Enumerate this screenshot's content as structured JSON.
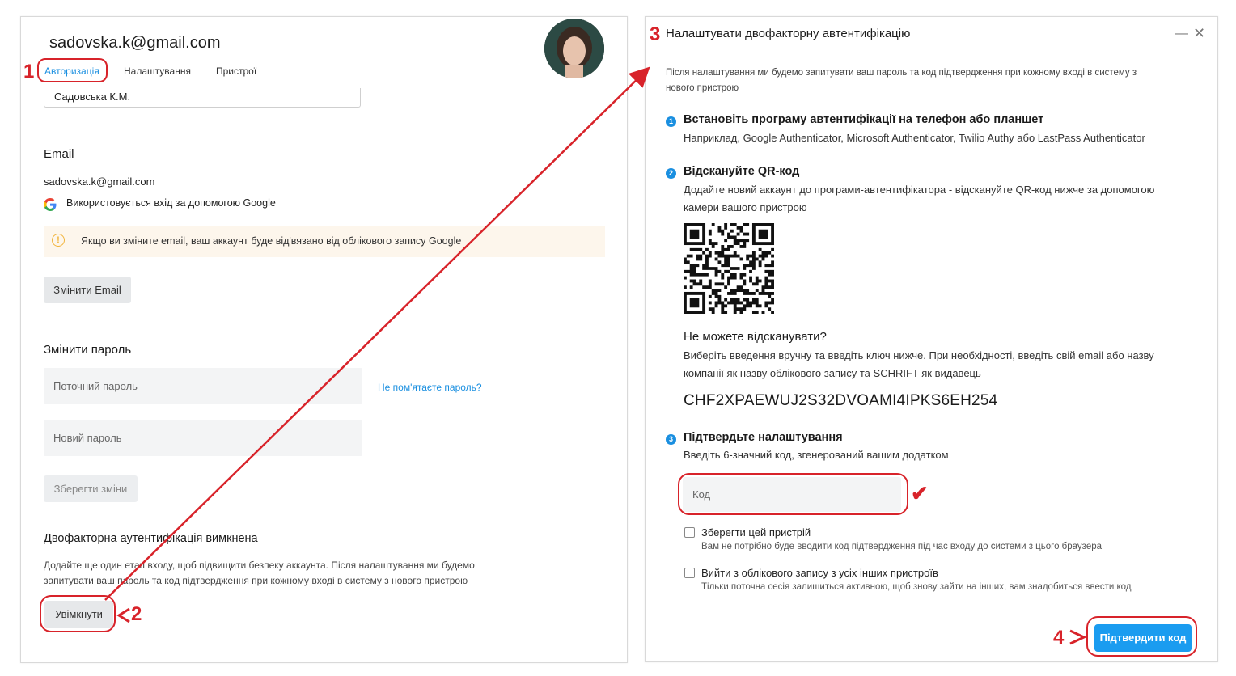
{
  "left": {
    "account_email": "sadovska.k@gmail.com",
    "tabs": [
      "Авторизація",
      "Налаштування",
      "Пристрої"
    ],
    "name_value": "Садовська К.М.",
    "email_section": {
      "title": "Email",
      "email": "sadovska.k@gmail.com",
      "google_note": "Використовується вхід за допомогою Google",
      "warning": "Якщо ви зміните email, ваш аккаунт буде від'вязано від облікового запису Google",
      "change_button": "Змінити Email"
    },
    "password_section": {
      "title": "Змінити пароль",
      "current_placeholder": "Поточний пароль",
      "forgot_link": "Не пом'ятаєте пароль?",
      "new_placeholder": "Новий пароль",
      "save_button": "Зберегти зміни"
    },
    "twofa_section": {
      "title": "Двофакторна аутентифікація вимкнена",
      "desc_line1": "Додайте ще один етап входу, щоб підвищити безпеку аккаунта. Після налаштування ми будемо",
      "desc_line2": "запитувати ваш пароль та код підтвердження при кожному вході в систему з нового пристрою",
      "enable_button": "Увімкнути"
    }
  },
  "right": {
    "title": "Налаштувати двофакторну автентифікацію",
    "intro_line1": "Після налаштування ми будемо запитувати ваш пароль та код підтвердження при кожному вході в систему з",
    "intro_line2": "нового пристрою",
    "steps": [
      {
        "num": "1",
        "title": "Встановіть програму автентифікації на телефон або планшет",
        "text": "Наприклад, Google Authenticator, Microsoft Authenticator, Twilio Authy або LastPass Authenticator"
      },
      {
        "num": "2",
        "title": "Відскануйте QR-код",
        "text1": "Додайте новий аккаунт до програми-автентифікатора - відскануйте QR-код нижче за допомогою",
        "text2": "камери вашого пристрою"
      },
      {
        "num": "3",
        "title": "Підтвердьте налаштування",
        "text": "Введіть 6-значний код, згенерований вашим додатком"
      }
    ],
    "cant_scan_title": "Не можете відсканувати?",
    "cant_scan_line1": "Виберіть введення вручну та введіть ключ нижче. При необхідності, введіть свій email або назву",
    "cant_scan_line2": "компанії як назву облікового запису та SCHRIFT як видавець",
    "secret_key": "CHF2XPAEWUJ2S32DVOAMI4IPKS6EH254",
    "code_placeholder": "Код",
    "remember_device": "Зберегти цей пристрій",
    "remember_device_sub": "Вам не потрібно буде вводити код підтвердження під час входу до системи з цього браузера",
    "logout_others": "Вийти з облікового запису з усіх інших пристроїв",
    "logout_others_sub": "Тільки поточна сесія залишиться активною, щоб знову зайти на інших, вам знадобиться ввести код",
    "confirm_button": "Підтвердити код"
  },
  "annotations": [
    "1",
    "2",
    "3",
    "4",
    "✔"
  ],
  "colors": {
    "accent": "#1a8fe0",
    "primary_button": "#1a9cf0",
    "annotation_red": "#d8232a",
    "warning_bg": "#fdf6ec"
  }
}
